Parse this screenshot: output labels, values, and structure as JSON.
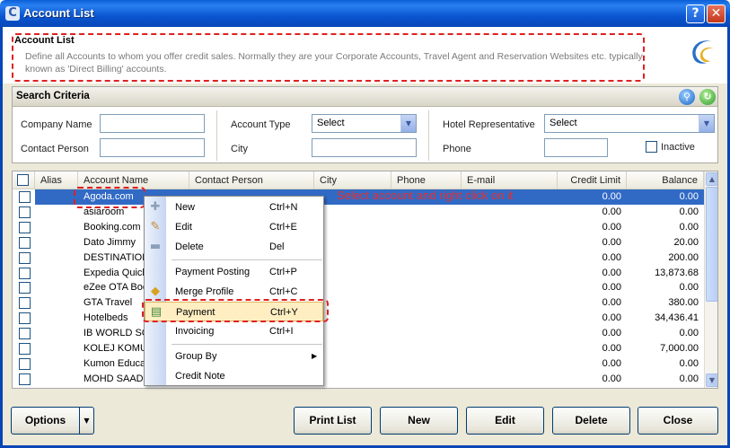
{
  "window": {
    "title": "Account List",
    "help_label": "?",
    "close_label": "✕"
  },
  "header": {
    "title": "Account List",
    "description": "Define all Accounts to whom you offer credit sales. Normally they are your Corporate Accounts, Travel Agent and Reservation Websites etc. typically known as 'Direct Billing' accounts."
  },
  "search": {
    "heading": "Search Criteria",
    "company_name_label": "Company Name",
    "contact_person_label": "Contact Person",
    "account_type_label": "Account Type",
    "account_type_value": "Select",
    "city_label": "City",
    "hotel_rep_label": "Hotel Representative",
    "hotel_rep_value": "Select",
    "phone_label": "Phone",
    "inactive_label": "Inactive"
  },
  "grid": {
    "columns": [
      "Alias",
      "Account Name",
      "Contact Person",
      "City",
      "Phone",
      "E-mail",
      "Credit Limit",
      "Balance"
    ],
    "rows": [
      {
        "name": "Agoda.com",
        "credit": "0.00",
        "balance": "0.00",
        "selected": true
      },
      {
        "name": "asiaroom",
        "credit": "0.00",
        "balance": "0.00"
      },
      {
        "name": "Booking.com",
        "credit": "0.00",
        "balance": "0.00"
      },
      {
        "name": "Dato Jimmy",
        "credit": "0.00",
        "balance": "20.00"
      },
      {
        "name": "DESTINATION",
        "credit": "0.00",
        "balance": "200.00"
      },
      {
        "name": "Expedia Quick",
        "credit": "0.00",
        "balance": "13,873.68"
      },
      {
        "name": "eZee OTA Boo",
        "credit": "0.00",
        "balance": "0.00"
      },
      {
        "name": "GTA Travel",
        "credit": "0.00",
        "balance": "380.00"
      },
      {
        "name": "Hotelbeds",
        "credit": "0.00",
        "balance": "34,436.41"
      },
      {
        "name": "IB WORLD SC",
        "credit": "0.00",
        "balance": "0.00"
      },
      {
        "name": "KOLEJ KOMUN",
        "credit": "0.00",
        "balance": "7,000.00"
      },
      {
        "name": "Kumon Educat",
        "credit": "0.00",
        "balance": "0.00"
      },
      {
        "name": "MOHD SAAD",
        "credit": "0.00",
        "balance": "0.00"
      }
    ]
  },
  "annotation": {
    "text": "Select account and right click on it"
  },
  "context_menu": {
    "items": [
      {
        "label": "New",
        "shortcut": "Ctrl+N",
        "icon": "plus-icon"
      },
      {
        "label": "Edit",
        "shortcut": "Ctrl+E",
        "icon": "edit-icon"
      },
      {
        "label": "Delete",
        "shortcut": "Del",
        "icon": "minus-icon"
      },
      {
        "label": "Payment Posting",
        "shortcut": "Ctrl+P"
      },
      {
        "label": "Merge Profile",
        "shortcut": "Ctrl+C",
        "icon": "merge-icon"
      },
      {
        "label": "Payment",
        "shortcut": "Ctrl+Y",
        "icon": "payment-icon"
      },
      {
        "label": "Invoicing",
        "shortcut": "Ctrl+I"
      },
      {
        "label": "Group By",
        "shortcut": "▶"
      },
      {
        "label": "Credit Note",
        "shortcut": ""
      }
    ]
  },
  "buttons": {
    "options": "Options",
    "print_list": "Print List",
    "new": "New",
    "edit": "Edit",
    "delete": "Delete",
    "close": "Close"
  }
}
